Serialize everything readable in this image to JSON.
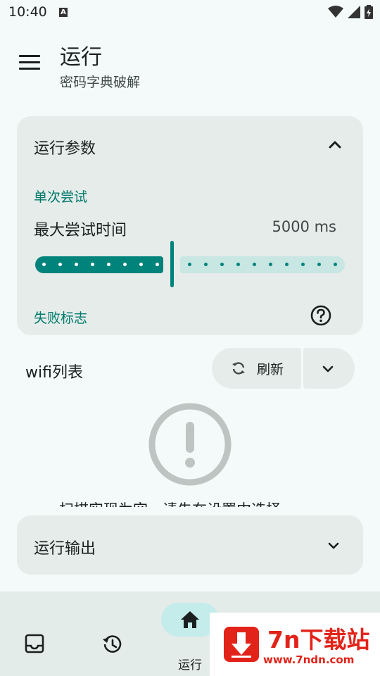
{
  "status_bar": {
    "time": "10:40",
    "notification_icon": "A"
  },
  "header": {
    "title": "运行",
    "subtitle": "密码字典破解"
  },
  "params_card": {
    "title": "运行参数",
    "section_single": "单次尝试",
    "slider": {
      "label": "最大尝试时间",
      "value_text": "5000 ms",
      "fraction": 0.44
    },
    "section_fail": "失败标志"
  },
  "wifi_section": {
    "label": "wifi列表",
    "refresh_label": "刷新",
    "empty_message": "扫描实现为空，请先在设置中选择"
  },
  "output_card": {
    "title": "运行输出"
  },
  "bottom_nav": {
    "items": [
      {
        "icon": "inbox-icon",
        "label": ""
      },
      {
        "icon": "history-icon",
        "label": ""
      },
      {
        "icon": "home-icon",
        "label": "运行",
        "selected": true
      }
    ]
  },
  "watermark": {
    "title": "7n下载站",
    "url": "www.7ndn.com"
  },
  "colors": {
    "accent": "#00837b",
    "accent_light": "#c8e6e2",
    "card": "#e5ecea",
    "background": "#f3faf9",
    "watermark_red": "#e2231a"
  }
}
